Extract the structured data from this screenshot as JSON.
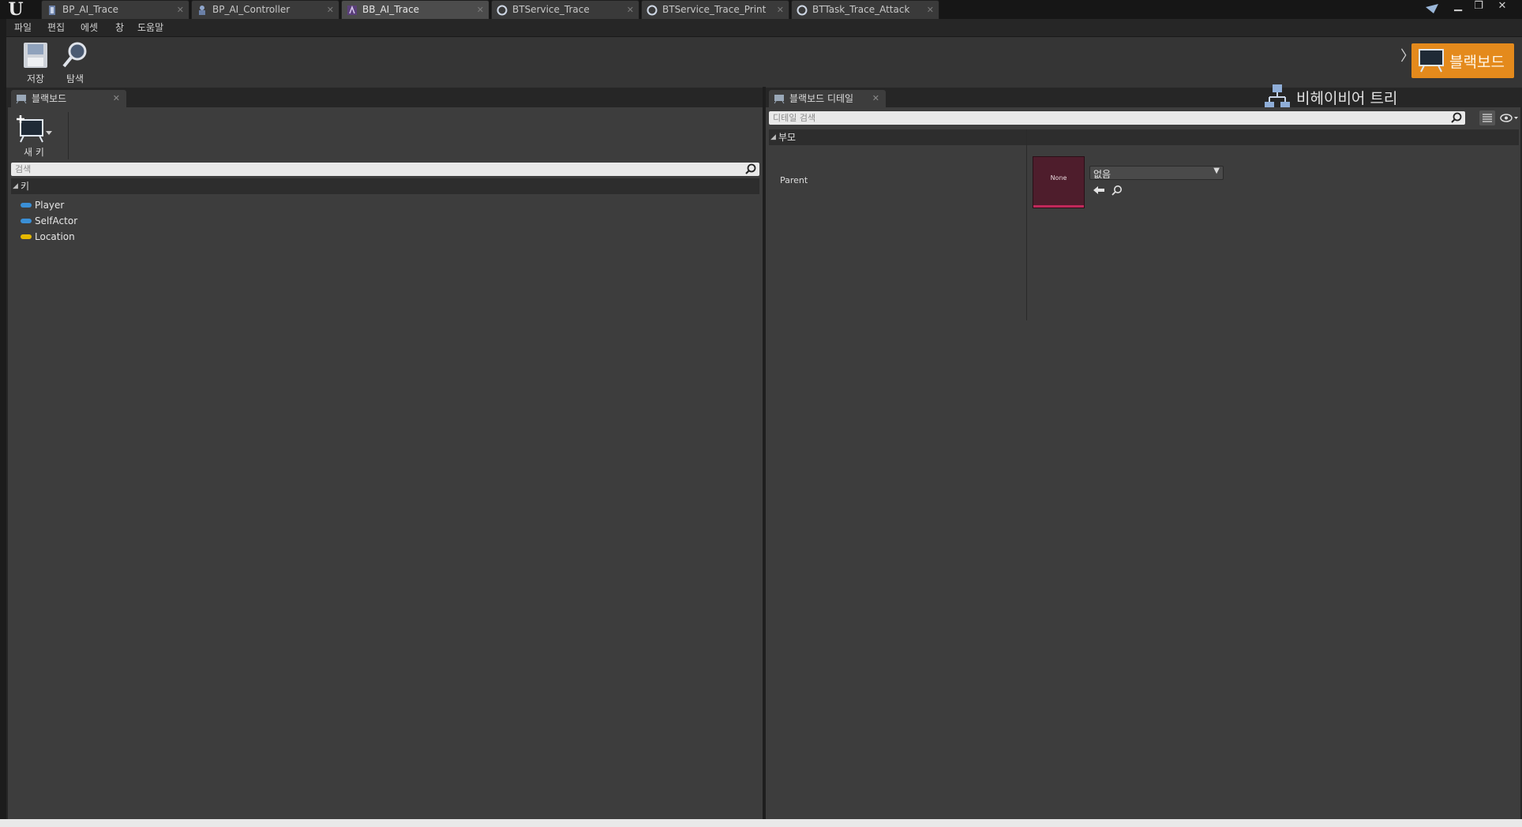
{
  "tabs": [
    {
      "label": "BP_AI_Trace",
      "icon": "blueprint-class-icon"
    },
    {
      "label": "BP_AI_Controller",
      "icon": "ai-controller-icon"
    },
    {
      "label": "BB_AI_Trace",
      "icon": "blackboard-asset-icon"
    },
    {
      "label": "BTService_Trace",
      "icon": "bt-node-icon"
    },
    {
      "label": "BTService_Trace_Print",
      "icon": "bt-node-icon"
    },
    {
      "label": "BTTask_Trace_Attack",
      "icon": "bt-node-icon"
    }
  ],
  "active_tab": "BB_AI_Trace",
  "menu": [
    "파일",
    "편집",
    "에셋",
    "창",
    "도움말"
  ],
  "toolbar": {
    "save_label": "저장",
    "browse_label": "탐색"
  },
  "modes": {
    "behavior_tree": "비헤이비어 트리",
    "separator": "〉",
    "blackboard": "블랙보드"
  },
  "blackboard_panel": {
    "tab_label": "블랙보드",
    "new_key_label": "새 키",
    "search_placeholder": "검색",
    "section_label": "키",
    "keys": [
      {
        "name": "Player",
        "color": "#3a8fd6"
      },
      {
        "name": "SelfActor",
        "color": "#3a8fd6"
      },
      {
        "name": "Location",
        "color": "#e6b800"
      }
    ]
  },
  "details_panel": {
    "tab_label": "블랙보드 디테일",
    "search_placeholder": "디테일 검색",
    "section_label": "부모",
    "property_label": "Parent",
    "thumbnail_text": "None",
    "combo_value": "없음"
  },
  "colors": {
    "accent_orange": "#e48a1c",
    "thumbnail_bg": "#4e1d2c",
    "thumbnail_bar": "#c0285a"
  }
}
